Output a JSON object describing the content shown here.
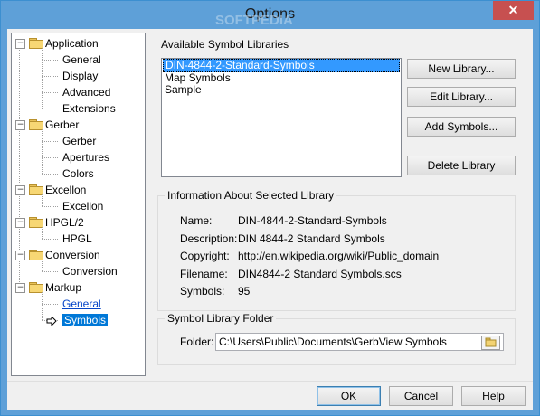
{
  "window": {
    "title": "Options",
    "close_glyph": "✕"
  },
  "watermark": "SOFTPEDIA",
  "tree": [
    {
      "label": "Application",
      "children": [
        "General",
        "Display",
        "Advanced",
        "Extensions"
      ]
    },
    {
      "label": "Gerber",
      "children": [
        "Gerber",
        "Apertures",
        "Colors"
      ]
    },
    {
      "label": "Excellon",
      "children": [
        "Excellon"
      ]
    },
    {
      "label": "HPGL/2",
      "children": [
        "HPGL"
      ]
    },
    {
      "label": "Conversion",
      "children": [
        "Conversion"
      ]
    },
    {
      "label": "Markup",
      "children": [
        "General",
        "Symbols"
      ]
    }
  ],
  "libraries": {
    "group_label": "Available Symbol Libraries",
    "items": [
      "DIN-4844-2-Standard-Symbols",
      "Map Symbols",
      "Sample"
    ],
    "selected_index": 0,
    "buttons": {
      "new": "New Library...",
      "edit": "Edit Library...",
      "add": "Add Symbols...",
      "delete": "Delete Library"
    }
  },
  "info": {
    "group_label": "Information About Selected Library",
    "fields": [
      {
        "label": "Name:",
        "value": "DIN-4844-2-Standard-Symbols"
      },
      {
        "label": "Description:",
        "value": "DIN 4844-2 Standard Symbols"
      },
      {
        "label": "Copyright:",
        "value": "http://en.wikipedia.org/wiki/Public_domain"
      },
      {
        "label": "Filename:",
        "value": "DIN4844-2 Standard Symbols.scs"
      },
      {
        "label": "Symbols:",
        "value": "95"
      }
    ]
  },
  "folder": {
    "group_label": "Symbol Library Folder",
    "field_label": "Folder:",
    "value": "C:\\Users\\Public\\Documents\\GerbView Symbols"
  },
  "dialog_buttons": {
    "ok": "OK",
    "cancel": "Cancel",
    "help": "Help"
  },
  "colors": {
    "titlebar": "#5ea0d8",
    "close": "#c75050",
    "selection": "#0078d7",
    "link": "#0645c8"
  }
}
